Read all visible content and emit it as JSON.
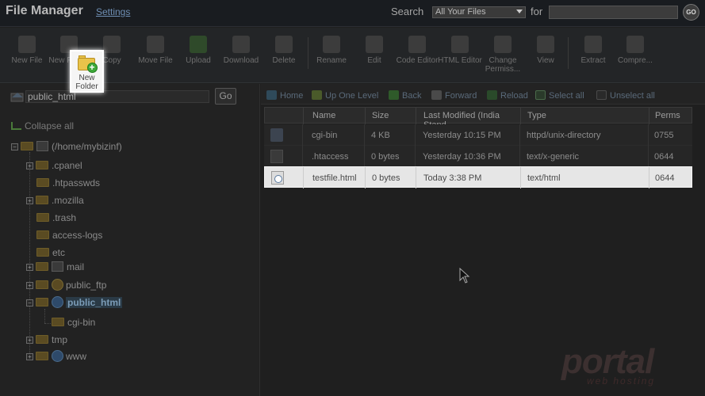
{
  "header": {
    "title": "File Manager",
    "settings_label": "Settings",
    "search_label": "Search",
    "search_scope": "All Your Files",
    "for_label": "for",
    "search_value": "",
    "go_label": "GO"
  },
  "toolbar": {
    "items": [
      {
        "label": "New File",
        "icon": "new-file-icon"
      },
      {
        "label": "New Folder",
        "icon": "new-folder-icon"
      },
      {
        "label": "Copy",
        "icon": "copy-icon"
      },
      {
        "label": "Move File",
        "icon": "move-file-icon"
      },
      {
        "label": "Upload",
        "icon": "upload-icon"
      },
      {
        "label": "Download",
        "icon": "download-icon"
      },
      {
        "label": "Delete",
        "icon": "delete-icon"
      },
      {
        "label": "Rename",
        "icon": "rename-icon"
      },
      {
        "label": "Edit",
        "icon": "edit-icon"
      },
      {
        "label": "Code Editor",
        "icon": "code-editor-icon"
      },
      {
        "label": "HTML Editor",
        "icon": "html-editor-icon"
      },
      {
        "label": "Change Permiss...",
        "icon": "change-permissions-icon"
      },
      {
        "label": "View",
        "icon": "view-icon"
      },
      {
        "label": "Extract",
        "icon": "extract-icon"
      },
      {
        "label": "Compre...",
        "icon": "compress-icon"
      }
    ],
    "highlight": {
      "line1": "New",
      "line2": "Folder"
    }
  },
  "left": {
    "path_value": "public_html",
    "go_label": "Go",
    "collapse_all": "Collapse all",
    "root": "(/home/mybizinf)",
    "tree": [
      {
        "label": ".cpanel",
        "expander": "+"
      },
      {
        "label": ".htpasswds",
        "expander": ""
      },
      {
        "label": ".mozilla",
        "expander": "+"
      },
      {
        "label": ".trash",
        "expander": ""
      },
      {
        "label": "access-logs",
        "expander": ""
      },
      {
        "label": "etc",
        "expander": ""
      },
      {
        "label": "mail",
        "expander": "+"
      },
      {
        "label": "public_ftp",
        "expander": "+"
      },
      {
        "label": "public_html",
        "expander": "−"
      },
      {
        "label": "cgi-bin",
        "expander": ""
      },
      {
        "label": "tmp",
        "expander": "+"
      },
      {
        "label": "www",
        "expander": "+"
      }
    ]
  },
  "nav": {
    "home": "Home",
    "up": "Up One Level",
    "back": "Back",
    "forward": "Forward",
    "reload": "Reload",
    "select_all": "Select all",
    "unselect_all": "Unselect all"
  },
  "table": {
    "headers": [
      "Name",
      "Size",
      "Last Modified (India Stand",
      "Type",
      "Perms"
    ],
    "rows": [
      {
        "name": "cgi-bin",
        "size": "4 KB",
        "modified": "Yesterday 10:15 PM",
        "type": "httpd/unix-directory",
        "perms": "0755",
        "icon": "folder-icon"
      },
      {
        "name": ".htaccess",
        "size": "0 bytes",
        "modified": "Yesterday 10:36 PM",
        "type": "text/x-generic",
        "perms": "0644",
        "icon": "generic-file-icon"
      },
      {
        "name": "testfile.html",
        "size": "0 bytes",
        "modified": "Today 3:38 PM",
        "type": "text/html",
        "perms": "0644",
        "icon": "html-file-icon"
      }
    ]
  },
  "watermark": {
    "brand": "portal",
    "sub": "web hosting"
  }
}
